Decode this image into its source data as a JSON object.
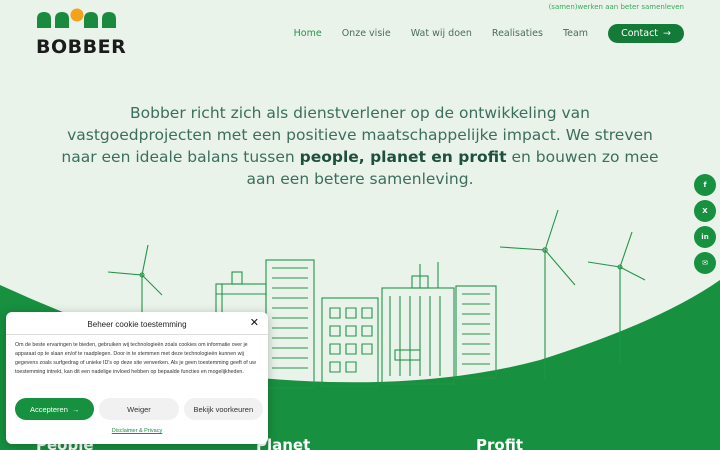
{
  "header": {
    "tagline": "(samen)werken aan beter samenleven",
    "logo_text": "BOBBER"
  },
  "nav": {
    "items": [
      "Home",
      "Onze visie",
      "Wat wij doen",
      "Realisaties",
      "Team"
    ],
    "contact_label": "Contact"
  },
  "intro": {
    "line_part1": "Bobber richt zich als dienstverlener op de ontwikkeling van vastgoedprojecten met een positieve maatschappelijke impact. We streven naar een ideale balans tussen ",
    "bold": "people, planet en profit",
    "line_part2": " en bouwen zo mee aan een betere samenleving."
  },
  "social": {
    "facebook": "f",
    "x": "X",
    "linkedin": "in",
    "email": "✉"
  },
  "pillars": [
    "People",
    "Planet",
    "Profit"
  ],
  "cookie": {
    "title": "Beheer cookie toestemming",
    "text": "Om de beste ervaringen te bieden, gebruiken wij technologieën zoals cookies om informatie over je apparaat op te slaan en/of te raadplegen. Door in te stemmen met deze technologieën kunnen wij gegevens zoals surfgedrag of unieke ID's op deze site verwerken. Als je geen toestemming geeft of uw toestemming intrekt, kan dit een nadelige invloed hebben op bepaalde functies en mogelijkheden.",
    "accept_label": "Accepteren",
    "deny_label": "Weiger",
    "prefs_label": "Bekijk voorkeuren",
    "link_label": "Disclaimer & Privacy"
  },
  "colors": {
    "brand_green": "#17903f",
    "logo_orange": "#f4a11c",
    "background": "#e9f3ea"
  }
}
